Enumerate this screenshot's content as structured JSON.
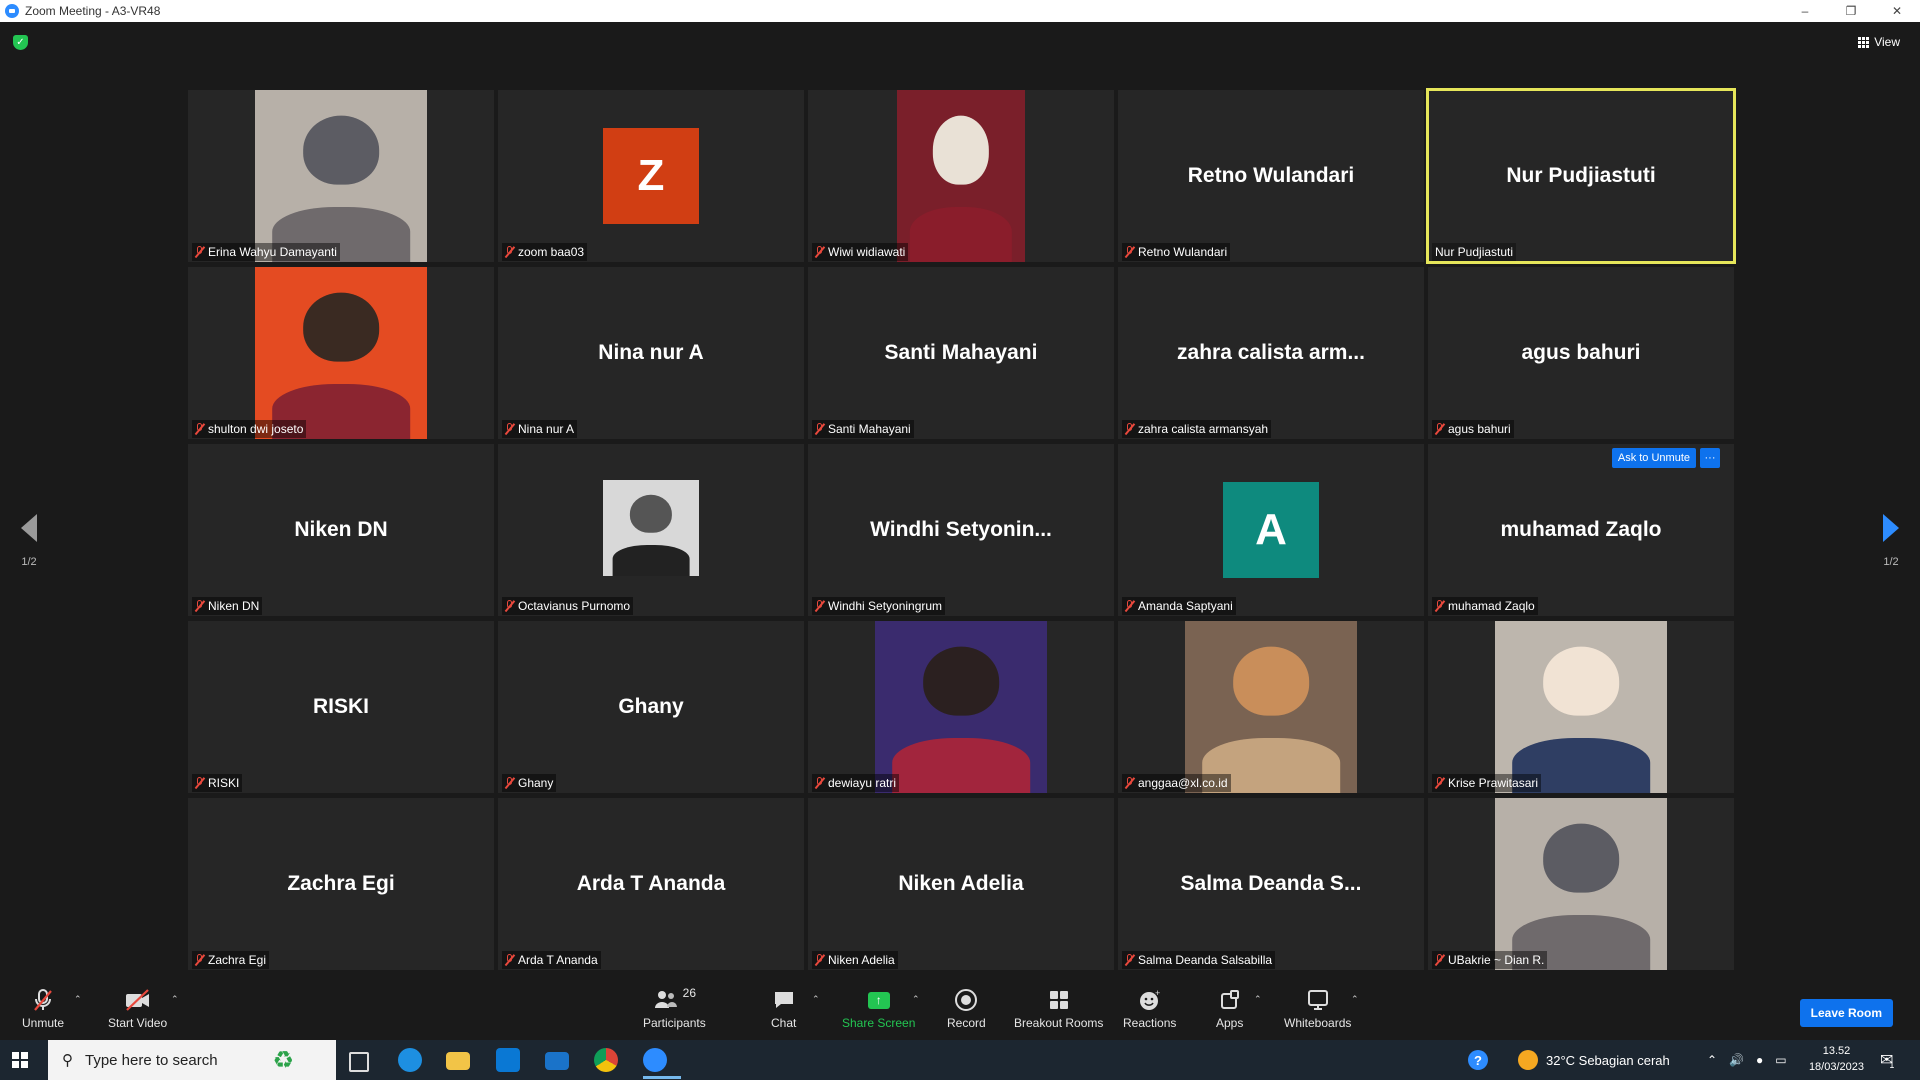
{
  "window": {
    "title": "Zoom Meeting - A3-VR48"
  },
  "top": {
    "view_label": "View"
  },
  "pagination": {
    "left": "1/2",
    "right": "1/2"
  },
  "tiles": [
    {
      "name": "Erina Wahyu Damayanti",
      "display": "",
      "type": "video",
      "muted": true
    },
    {
      "name": "zoom baa03",
      "display": "",
      "type": "avatar",
      "letter": "Z",
      "color": "#d13e13",
      "muted": true
    },
    {
      "name": "Wiwi widiawati",
      "display": "",
      "type": "video",
      "muted": true
    },
    {
      "name": "Retno Wulandari",
      "display": "Retno Wulandari",
      "type": "name",
      "muted": true
    },
    {
      "name": "Nur Pudjiastuti",
      "display": "Nur Pudjiastuti",
      "type": "name",
      "muted": false,
      "active": true
    },
    {
      "name": "shulton dwi joseto",
      "display": "",
      "type": "video",
      "muted": true
    },
    {
      "name": "Nina nur A",
      "display": "Nina nur A",
      "type": "name",
      "muted": true
    },
    {
      "name": "Santi Mahayani",
      "display": "Santi Mahayani",
      "type": "name",
      "muted": true
    },
    {
      "name": "zahra calista armansyah",
      "display": "zahra calista arm...",
      "type": "name",
      "muted": true
    },
    {
      "name": "agus bahuri",
      "display": "agus bahuri",
      "type": "name",
      "muted": true
    },
    {
      "name": "Niken DN",
      "display": "Niken DN",
      "type": "name",
      "muted": true
    },
    {
      "name": "Octavianus Purnomo",
      "display": "",
      "type": "photo-small",
      "muted": true
    },
    {
      "name": "Windhi Setyoningrum",
      "display": "Windhi  Setyonin...",
      "type": "name",
      "muted": true
    },
    {
      "name": "Amanda Saptyani",
      "display": "",
      "type": "avatar",
      "letter": "A",
      "color": "#0e8a7e",
      "muted": true
    },
    {
      "name": "muhamad Zaqlo",
      "display": "muhamad Zaqlo",
      "type": "name",
      "muted": true,
      "actions": true
    },
    {
      "name": "RISKI",
      "display": "RISKI",
      "type": "name",
      "muted": true
    },
    {
      "name": "Ghany",
      "display": "Ghany",
      "type": "name",
      "muted": true
    },
    {
      "name": "dewiayu ratri",
      "display": "",
      "type": "video",
      "muted": true
    },
    {
      "name": "anggaa@xl.co.id",
      "display": "",
      "type": "video",
      "muted": true
    },
    {
      "name": "Krise Prawitasari",
      "display": "",
      "type": "video",
      "muted": true
    },
    {
      "name": "Zachra Egi",
      "display": "Zachra Egi",
      "type": "name",
      "muted": true
    },
    {
      "name": "Arda T Ananda",
      "display": "Arda T Ananda",
      "type": "name",
      "muted": true
    },
    {
      "name": "Niken Adelia",
      "display": "Niken Adelia",
      "type": "name",
      "muted": true
    },
    {
      "name": "Salma Deanda Salsabilla",
      "display": "Salma  Deanda  S...",
      "type": "name",
      "muted": true
    },
    {
      "name": "UBakrie ~ Dian R.",
      "display": "",
      "type": "video",
      "muted": true
    }
  ],
  "tile_actions": {
    "ask_to_unmute": "Ask to Unmute",
    "more": "···"
  },
  "toolbar": {
    "unmute": "Unmute",
    "start_video": "Start Video",
    "participants": "Participants",
    "participants_count": "26",
    "chat": "Chat",
    "share_screen": "Share Screen",
    "record": "Record",
    "breakout_rooms": "Breakout Rooms",
    "reactions": "Reactions",
    "apps": "Apps",
    "whiteboards": "Whiteboards",
    "leave_room": "Leave Room"
  },
  "taskbar": {
    "search_placeholder": "Type here to search",
    "weather": "32°C  Sebagian cerah",
    "time": "13.52",
    "date": "18/03/2023",
    "notification_count": "1"
  },
  "colors": {
    "accent": "#0e72ed",
    "share_green": "#23c552",
    "active_speaker": "#e6e65a",
    "muted_red": "#e8483c"
  }
}
